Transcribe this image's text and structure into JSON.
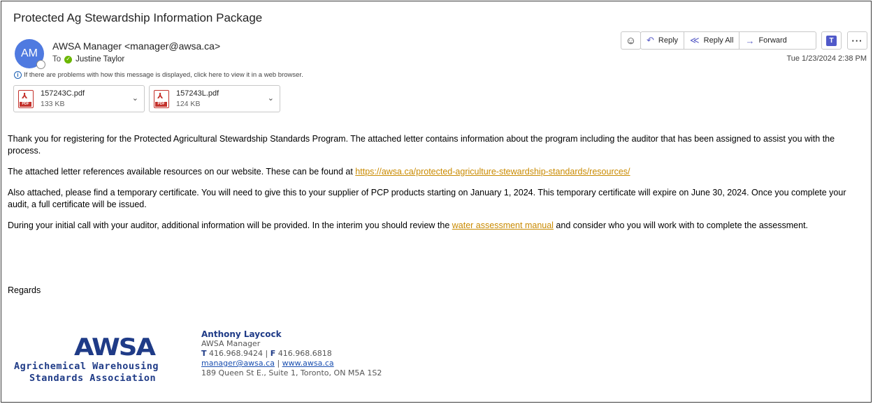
{
  "message": {
    "subject": "Protected Ag Stewardship Information Package",
    "avatar_initials": "AM",
    "sender": "AWSA Manager <manager@awsa.ca>",
    "to_label": "To",
    "recipient": "Justine Taylor",
    "info_text": "If there are problems with how this message is displayed, click here to view it in a web browser.",
    "date": "Tue 1/23/2024 2:38 PM"
  },
  "attachments": [
    {
      "name": "157243C.pdf",
      "size": "133 KB"
    },
    {
      "name": "157243L.pdf",
      "size": "124 KB"
    }
  ],
  "toolbar": {
    "reply": "Reply",
    "reply_all": "Reply All",
    "forward": "Forward"
  },
  "body": {
    "p1": "Thank you for registering for the Protected Agricultural Stewardship Standards Program. The attached letter contains information about the program including the auditor that has been assigned to assist you with the process.",
    "p2_pre": "The attached letter references available resources on our website. These can be found at ",
    "p2_link": "https://awsa.ca/protected-agriculture-stewardship-standards/resources/",
    "p3": "Also attached, please find a temporary certificate. You will need to give this to your supplier of PCP products starting on January 1, 2024. This temporary certificate will expire on June 30, 2024. Once you complete your audit, a full certificate will be issued.",
    "p4_pre": "During your initial call with your auditor, additional information will be provided.  In the interim you should review the ",
    "p4_link": "water assessment manual",
    "p4_post": " and consider who you will work with to complete the assessment.",
    "regards": "Regards"
  },
  "signature": {
    "logo_mark": "AWSA",
    "logo_line1": "Agrichemical Warehousing",
    "logo_line2": "Standards Association",
    "name": "Anthony Laycock",
    "title": "AWSA Manager",
    "t_label": "T",
    "phone": "416.968.9424",
    "sep": "|",
    "f_label": "F",
    "fax": "416.968.6818",
    "email": "manager@awsa.ca",
    "website": "www.awsa.ca",
    "address": "189 Queen St E., Suite 1, Toronto, ON M5A 1S2"
  },
  "icons": {
    "emoji": "emoji-icon",
    "reply": "reply-icon",
    "reply_all": "reply-all-icon",
    "forward": "forward-icon",
    "teams": "teams-icon",
    "more": "more-icon",
    "pdf": "pdf-icon",
    "chevron": "chevron-down-icon",
    "info": "info-icon"
  },
  "colors": {
    "avatar": "#4f7ae0",
    "link": "#c98a00",
    "brand": "#1f3b87",
    "pdf": "#c4312b"
  }
}
